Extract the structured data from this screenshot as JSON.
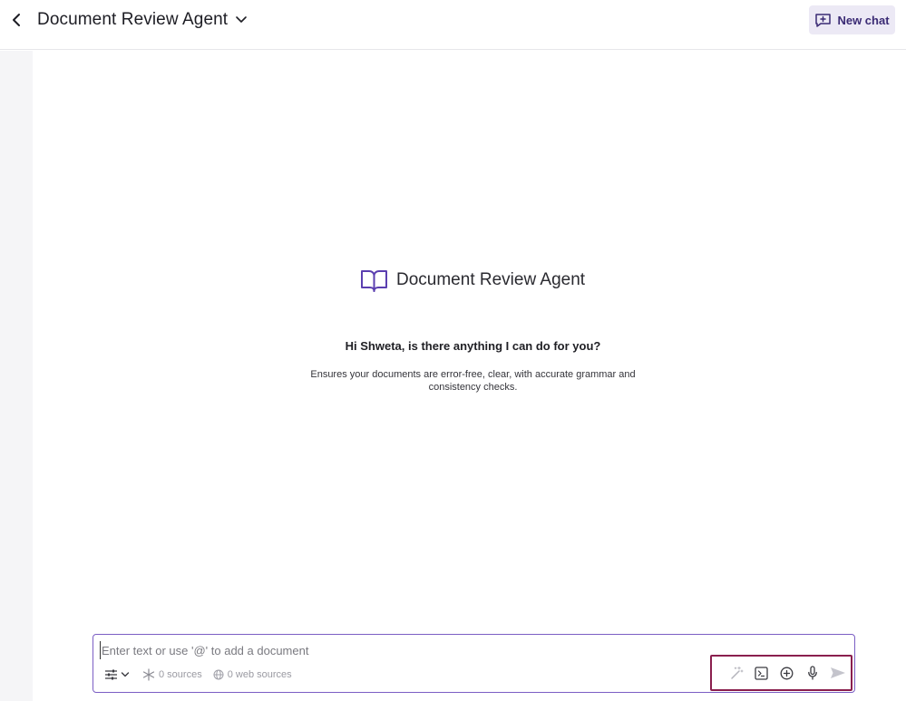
{
  "header": {
    "title": "Document Review Agent",
    "new_chat_label": "New chat"
  },
  "agent": {
    "name": "Document Review Agent",
    "greeting": "Hi Shweta, is there anything I can do for you?",
    "description": "Ensures your documents are error-free, clear, with accurate grammar and consistency checks."
  },
  "composer": {
    "placeholder": "Enter text or use '@' to add a document",
    "value": "",
    "sources_label": "0 sources",
    "web_sources_label": "0 web sources"
  },
  "icons": {
    "back": "chevron-left-icon",
    "title_dropdown": "chevron-down-icon",
    "new_chat": "message-plus-icon",
    "agent": "book-open-icon",
    "filter": "sliders-icon",
    "sources": "sparkle-icon",
    "web_sources": "globe-icon",
    "magic": "magic-wand-icon",
    "terminal": "terminal-icon",
    "add": "plus-circle-icon",
    "mic": "microphone-icon",
    "send": "send-icon"
  },
  "colors": {
    "accent": "#5b3fb0",
    "composer_border": "#7b5ec4",
    "highlight_box": "#8a1f4e",
    "new_chat_bg": "#ece9f5"
  }
}
